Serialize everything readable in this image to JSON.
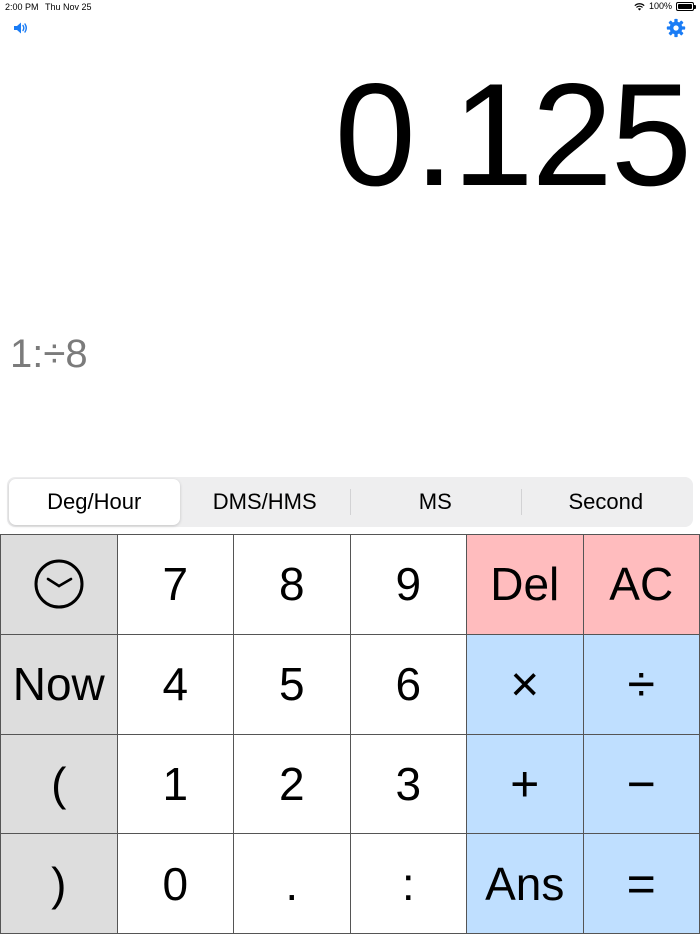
{
  "status_bar": {
    "time": "2:00 PM",
    "date": "Thu Nov 25",
    "battery": "100%"
  },
  "icons": {
    "sound": "speaker-icon",
    "settings": "gear-icon",
    "clock": "clock-icon",
    "wifi": "wifi-icon",
    "battery": "battery-icon"
  },
  "colors": {
    "accent": "#1a7cf5",
    "red_key": "#ffbcbe",
    "blue_key": "#bfdfff",
    "gray_key": "#dddddd",
    "expression_text": "#7b7b7b"
  },
  "display": {
    "value": "0.125",
    "expression": "1:÷8"
  },
  "modes": {
    "selected": "Deg/Hour",
    "items": [
      "Deg/Hour",
      "DMS/HMS",
      "MS",
      "Second"
    ]
  },
  "keys": {
    "row1": [
      "7",
      "8",
      "9",
      "Del",
      "AC"
    ],
    "row2": [
      "Now",
      "4",
      "5",
      "6",
      "×",
      "÷"
    ],
    "row3": [
      "(",
      "1",
      "2",
      "3",
      "+",
      "−"
    ],
    "row4": [
      ")",
      "0",
      ".",
      ":",
      "Ans",
      "="
    ]
  }
}
